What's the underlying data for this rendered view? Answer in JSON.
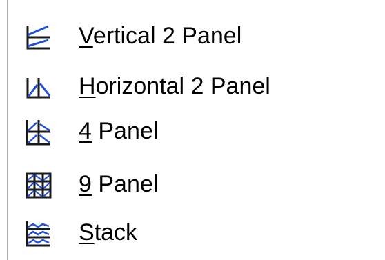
{
  "menu": {
    "items": [
      {
        "icon": "vertical-2-panel-icon",
        "accel": "V",
        "rest": "ertical 2 Panel"
      },
      {
        "icon": "horizontal-2-panel-icon",
        "accel": "H",
        "rest": "orizontal 2 Panel"
      },
      {
        "icon": "4-panel-icon",
        "accel": "4",
        "rest": " Panel"
      },
      {
        "icon": "9-panel-icon",
        "accel": "9",
        "rest": " Panel"
      },
      {
        "icon": "stack-icon",
        "accel": "S",
        "rest": "tack"
      }
    ]
  },
  "colors": {
    "icon_dark": "#1a1a1a",
    "icon_blue": "#1f4fd8",
    "border": "#b4b4b4"
  }
}
